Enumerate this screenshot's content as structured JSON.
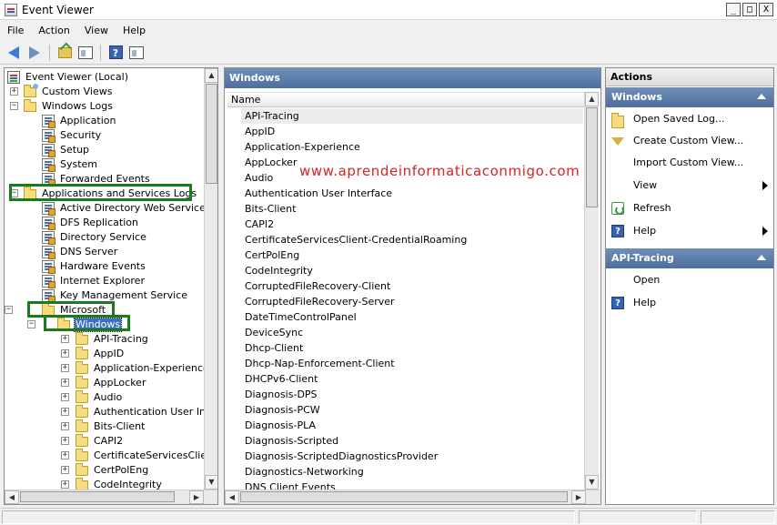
{
  "window": {
    "title": "Event Viewer",
    "buttons": [
      "_",
      "□",
      "X"
    ]
  },
  "menu": [
    "File",
    "Action",
    "View",
    "Help"
  ],
  "toolbar": {
    "icons": [
      "back-arrow-icon",
      "forward-arrow-icon",
      "up-folder-icon",
      "show-hide-tree-icon",
      "help-icon",
      "show-hide-action-pane-icon"
    ]
  },
  "tree": {
    "items": [
      {
        "label": "Event Viewer (Local)",
        "icon": "event-viewer-icon",
        "depth": 0,
        "expander": ""
      },
      {
        "label": "Custom Views",
        "icon": "folder-icon",
        "depth": 1,
        "expander": "+"
      },
      {
        "label": "Windows Logs",
        "icon": "folder-icon",
        "depth": 1,
        "expander": "−"
      },
      {
        "label": "Application",
        "icon": "log-icon",
        "depth": 2,
        "expander": ""
      },
      {
        "label": "Security",
        "icon": "log-icon",
        "depth": 2,
        "expander": ""
      },
      {
        "label": "Setup",
        "icon": "log-icon",
        "depth": 2,
        "expander": ""
      },
      {
        "label": "System",
        "icon": "log-icon",
        "depth": 2,
        "expander": ""
      },
      {
        "label": "Forwarded Events",
        "icon": "log-icon",
        "depth": 2,
        "expander": ""
      },
      {
        "label": "Applications and Services Logs",
        "icon": "folder-icon",
        "depth": 1,
        "expander": "−"
      },
      {
        "label": "Active Directory Web Services",
        "icon": "log-icon",
        "depth": 2,
        "expander": ""
      },
      {
        "label": "DFS Replication",
        "icon": "log-icon",
        "depth": 2,
        "expander": ""
      },
      {
        "label": "Directory Service",
        "icon": "log-icon",
        "depth": 2,
        "expander": ""
      },
      {
        "label": "DNS Server",
        "icon": "log-icon",
        "depth": 2,
        "expander": ""
      },
      {
        "label": "Hardware Events",
        "icon": "log-icon",
        "depth": 2,
        "expander": ""
      },
      {
        "label": "Internet Explorer",
        "icon": "log-icon",
        "depth": 2,
        "expander": ""
      },
      {
        "label": "Key Management Service",
        "icon": "log-icon",
        "depth": 2,
        "expander": ""
      },
      {
        "label": "Microsoft",
        "icon": "folder-icon",
        "depth": 2,
        "expander": "−"
      },
      {
        "label": "Windows",
        "icon": "folder-icon",
        "depth": 3,
        "expander": "−",
        "selected": true
      },
      {
        "label": "API-Tracing",
        "icon": "folder-icon",
        "depth": 4,
        "expander": "+"
      },
      {
        "label": "AppID",
        "icon": "folder-icon",
        "depth": 4,
        "expander": "+"
      },
      {
        "label": "Application-Experience",
        "icon": "folder-icon",
        "depth": 4,
        "expander": "+"
      },
      {
        "label": "AppLocker",
        "icon": "folder-icon",
        "depth": 4,
        "expander": "+"
      },
      {
        "label": "Audio",
        "icon": "folder-icon",
        "depth": 4,
        "expander": "+"
      },
      {
        "label": "Authentication User Inter",
        "icon": "folder-icon",
        "depth": 4,
        "expander": "+"
      },
      {
        "label": "Bits-Client",
        "icon": "folder-icon",
        "depth": 4,
        "expander": "+"
      },
      {
        "label": "CAPI2",
        "icon": "folder-icon",
        "depth": 4,
        "expander": "+"
      },
      {
        "label": "CertificateServicesClient-",
        "icon": "folder-icon",
        "depth": 4,
        "expander": "+"
      },
      {
        "label": "CertPolEng",
        "icon": "folder-icon",
        "depth": 4,
        "expander": "+"
      },
      {
        "label": "CodeIntegrity",
        "icon": "folder-icon",
        "depth": 4,
        "expander": "+"
      }
    ]
  },
  "center": {
    "title": "Windows",
    "column_header": "Name",
    "watermark": "www.aprendeinformaticaconmigo.com",
    "items": [
      "API-Tracing",
      "AppID",
      "Application-Experience",
      "AppLocker",
      "Audio",
      "Authentication User Interface",
      "Bits-Client",
      "CAPI2",
      "CertificateServicesClient-CredentialRoaming",
      "CertPolEng",
      "CodeIntegrity",
      "CorruptedFileRecovery-Client",
      "CorruptedFileRecovery-Server",
      "DateTimeControlPanel",
      "DeviceSync",
      "Dhcp-Client",
      "Dhcp-Nap-Enforcement-Client",
      "DHCPv6-Client",
      "Diagnosis-DPS",
      "Diagnosis-PCW",
      "Diagnosis-PLA",
      "Diagnosis-Scripted",
      "Diagnosis-ScriptedDiagnosticsProvider",
      "Diagnostics-Networking",
      "DNS Client Events"
    ]
  },
  "actions": {
    "title": "Actions",
    "sections": [
      {
        "name": "Windows",
        "items": [
          {
            "label": "Open Saved Log...",
            "icon": "open-folder-icon",
            "submenu": false
          },
          {
            "label": "Create Custom View...",
            "icon": "filter-icon",
            "submenu": false
          },
          {
            "label": "Import Custom View...",
            "icon": "",
            "submenu": false
          },
          {
            "label": "View",
            "icon": "",
            "submenu": true
          },
          {
            "label": "Refresh",
            "icon": "refresh-icon",
            "submenu": false
          },
          {
            "label": "Help",
            "icon": "help-icon",
            "submenu": true
          }
        ]
      },
      {
        "name": "API-Tracing",
        "items": [
          {
            "label": "Open",
            "icon": "",
            "submenu": false
          },
          {
            "label": "Help",
            "icon": "help-icon",
            "submenu": false
          }
        ]
      }
    ]
  },
  "colors": {
    "header_blue": "#4d6f9e",
    "highlight_green": "#1b7a1b",
    "watermark_red": "#d42424",
    "selection_blue": "#3d6ec9"
  }
}
